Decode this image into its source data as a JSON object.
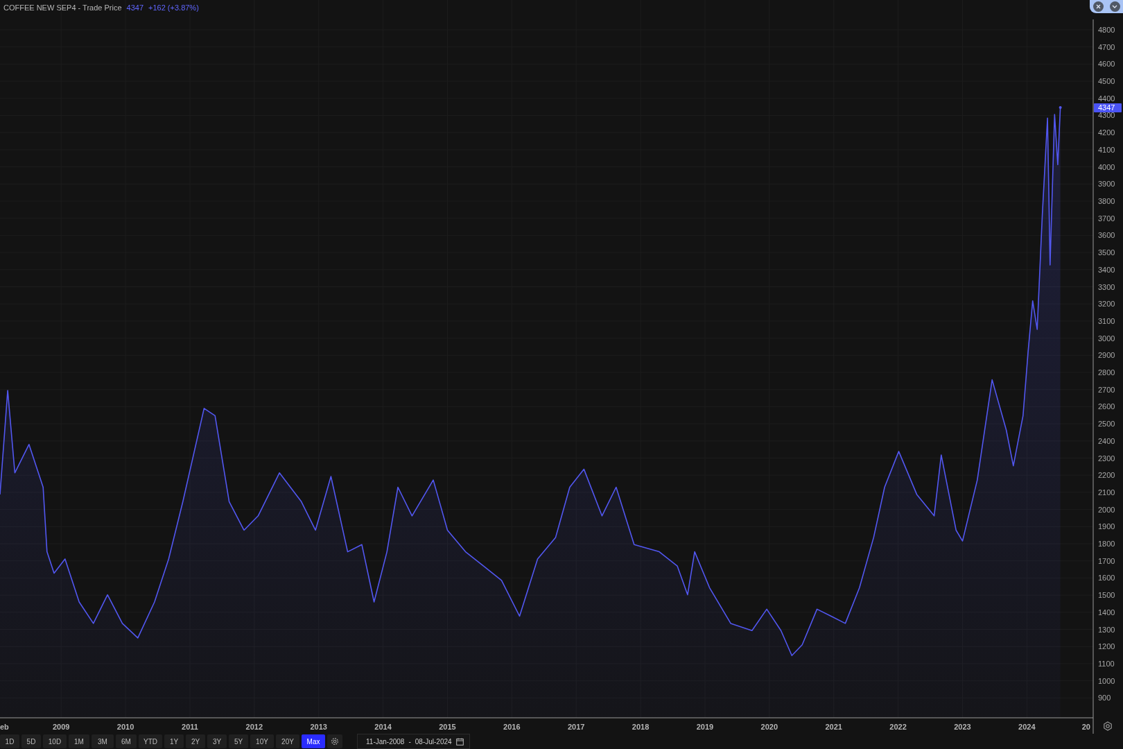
{
  "header": {
    "instrument": "COFFEE NEW SEP4 - Trade Price",
    "last": "4347",
    "change": "+162 (+3.87%)"
  },
  "chart": {
    "last_price_label": "4347",
    "cut_x_labels": [
      {
        "kind": "start",
        "label": "eb"
      },
      {
        "kind": "end",
        "label": "20"
      }
    ],
    "chart_data": {
      "type": "area",
      "grid": true,
      "xlim": [
        2008.05,
        2025.03
      ],
      "ylim": [
        784,
        4974
      ],
      "yticks": [
        900,
        1000,
        1100,
        1200,
        1300,
        1400,
        1500,
        1600,
        1700,
        1800,
        1900,
        2000,
        2100,
        2200,
        2300,
        2400,
        2500,
        2600,
        2700,
        2800,
        2900,
        3000,
        3100,
        3200,
        3300,
        3400,
        3500,
        3600,
        3700,
        3800,
        3900,
        4000,
        4100,
        4200,
        4300,
        4400,
        4500,
        4600,
        4700,
        4800
      ],
      "xticks": [
        {
          "value": 2009,
          "label": "2009"
        },
        {
          "value": 2010,
          "label": "2010"
        },
        {
          "value": 2011,
          "label": "2011"
        },
        {
          "value": 2012,
          "label": "2012"
        },
        {
          "value": 2013,
          "label": "2013"
        },
        {
          "value": 2014,
          "label": "2014"
        },
        {
          "value": 2015,
          "label": "2015"
        },
        {
          "value": 2016,
          "label": "2016"
        },
        {
          "value": 2017,
          "label": "2017"
        },
        {
          "value": 2018,
          "label": "2018"
        },
        {
          "value": 2019,
          "label": "2019"
        },
        {
          "value": 2020,
          "label": "2020"
        },
        {
          "value": 2021,
          "label": "2021"
        },
        {
          "value": 2022,
          "label": "2022"
        },
        {
          "value": 2023,
          "label": "2023"
        },
        {
          "value": 2024,
          "label": "2024"
        }
      ],
      "x": [
        2008.05,
        2008.17,
        2008.28,
        2008.5,
        2008.72,
        2008.78,
        2008.89,
        2009.06,
        2009.28,
        2009.5,
        2009.72,
        2009.95,
        2010.19,
        2010.45,
        2010.67,
        2010.89,
        2011.22,
        2011.39,
        2011.61,
        2011.84,
        2012.06,
        2012.39,
        2012.73,
        2012.95,
        2013.19,
        2013.45,
        2013.67,
        2013.86,
        2014.06,
        2014.23,
        2014.45,
        2014.78,
        2015.0,
        2015.28,
        2015.56,
        2015.84,
        2016.12,
        2016.4,
        2016.68,
        2016.9,
        2017.12,
        2017.4,
        2017.62,
        2017.9,
        2018.29,
        2018.57,
        2018.73,
        2018.84,
        2019.07,
        2019.4,
        2019.73,
        2019.96,
        2020.18,
        2020.35,
        2020.51,
        2020.74,
        2020.96,
        2021.18,
        2021.4,
        2021.62,
        2021.79,
        2022.01,
        2022.29,
        2022.56,
        2022.67,
        2022.9,
        2023.0,
        2023.23,
        2023.46,
        2023.68,
        2023.79,
        2023.94,
        2024.02,
        2024.09,
        2024.16,
        2024.24,
        2024.32,
        2024.36,
        2024.43,
        2024.48,
        2024.52
      ],
      "series": [
        {
          "color": "#5257f0",
          "values": [
            2088,
            2695,
            2214,
            2380,
            2130,
            1753,
            1628,
            1711,
            1460,
            1335,
            1502,
            1335,
            1250,
            1460,
            1711,
            2046,
            2590,
            2548,
            2046,
            1879,
            1963,
            2214,
            2046,
            1879,
            2193,
            1753,
            1795,
            1460,
            1753,
            2130,
            1963,
            2172,
            1879,
            1753,
            1670,
            1586,
            1377,
            1711,
            1837,
            2130,
            2235,
            1963,
            2130,
            1795,
            1753,
            1670,
            1502,
            1753,
            1544,
            1335,
            1293,
            1418,
            1293,
            1147,
            1210,
            1418,
            1377,
            1335,
            1544,
            1837,
            2130,
            2339,
            2088,
            1963,
            2318,
            1879,
            1816,
            2172,
            2757,
            2464,
            2255,
            2548,
            2925,
            3218,
            3051,
            3720,
            4285,
            3427,
            4306,
            4013,
            4347
          ]
        }
      ]
    }
  },
  "toolbar": {
    "ranges": [
      {
        "label": "1D",
        "selected": false
      },
      {
        "label": "5D",
        "selected": false
      },
      {
        "label": "10D",
        "selected": false
      },
      {
        "label": "1M",
        "selected": false
      },
      {
        "label": "3M",
        "selected": false
      },
      {
        "label": "6M",
        "selected": false
      },
      {
        "label": "YTD",
        "selected": false
      },
      {
        "label": "1Y",
        "selected": false
      },
      {
        "label": "2Y",
        "selected": false
      },
      {
        "label": "3Y",
        "selected": false
      },
      {
        "label": "5Y",
        "selected": false
      },
      {
        "label": "10Y",
        "selected": false
      },
      {
        "label": "20Y",
        "selected": false
      },
      {
        "label": "Max",
        "selected": true
      }
    ],
    "date_from": "11-Jan-2008",
    "date_separator": "-",
    "date_to": "08-Jul-2024"
  }
}
